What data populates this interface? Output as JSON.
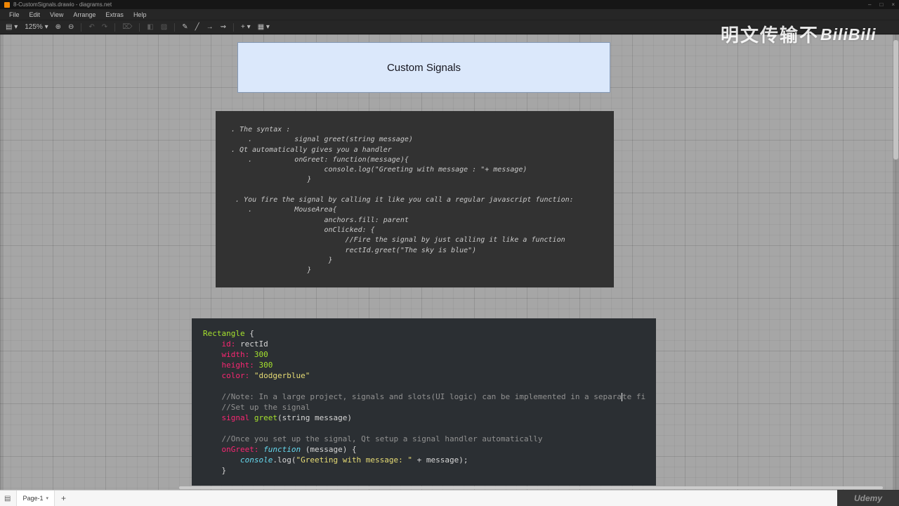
{
  "window": {
    "title": "8-CustomSignals.drawio - diagrams.net",
    "controls": {
      "minimize": "–",
      "maximize": "□",
      "close": "×"
    }
  },
  "menubar": [
    "File",
    "Edit",
    "View",
    "Arrange",
    "Extras",
    "Help"
  ],
  "toolbar": {
    "zoom_value": "125%",
    "buttons": [
      {
        "name": "diagram-menu",
        "glyph": "▤ ▾",
        "enabled": true
      },
      {
        "name": "zoom-dropdown",
        "glyph": "125% ▾",
        "enabled": true
      },
      {
        "name": "zoom-in",
        "glyph": "⊕",
        "enabled": true
      },
      {
        "name": "zoom-out",
        "glyph": "⊖",
        "enabled": true
      },
      {
        "name": "separator",
        "glyph": "",
        "sep": true
      },
      {
        "name": "undo",
        "glyph": "↶",
        "enabled": false
      },
      {
        "name": "redo",
        "glyph": "↷",
        "enabled": false
      },
      {
        "name": "separator",
        "glyph": "",
        "sep": true
      },
      {
        "name": "delete",
        "glyph": "⌦",
        "enabled": false
      },
      {
        "name": "separator",
        "glyph": "",
        "sep": true
      },
      {
        "name": "fill-color",
        "glyph": "◧",
        "enabled": false
      },
      {
        "name": "shadow",
        "glyph": "▨",
        "enabled": false
      },
      {
        "name": "separator",
        "glyph": "",
        "sep": true
      },
      {
        "name": "pencil",
        "glyph": "✎",
        "enabled": true
      },
      {
        "name": "line-style",
        "glyph": "╱",
        "enabled": true
      },
      {
        "name": "connection-arrow",
        "glyph": "→",
        "enabled": true
      },
      {
        "name": "waypoint-style",
        "glyph": "⇝",
        "enabled": true
      },
      {
        "name": "separator",
        "glyph": "",
        "sep": true
      },
      {
        "name": "insert",
        "glyph": "+ ▾",
        "enabled": true
      },
      {
        "name": "table",
        "glyph": "▦ ▾",
        "enabled": true
      }
    ]
  },
  "canvas": {
    "title_box": {
      "text": "Custom Signals",
      "fill": "#dbe8fb",
      "border": "#8499b7"
    },
    "notes_box": {
      "fill": "#323232",
      "lines": [
        ". The syntax :",
        "    .          signal greet(string message)",
        ". Qt automatically gives you a handler",
        "    .          onGreet: function(message){",
        "                      console.log(\"Greeting with message : \"+ message)",
        "                  }",
        "",
        " . You fire the signal by calling it like you call a regular javascript function:",
        "    .          MouseArea{",
        "                      anchors.fill: parent",
        "                      onClicked: {",
        "                           //Fire the signal by just calling it like a function",
        "                           rectId.greet(\"The sky is blue\")",
        "                       }",
        "                  }"
      ]
    },
    "code_box": {
      "fill": "#2b2f33",
      "palette": {
        "keyword": "#f92672",
        "type": "#a6e22e",
        "number": "#a6e22e",
        "string": "#e6db74",
        "builtin": "#66d9ef",
        "comment": "#919191",
        "plain": "#d6d6d6"
      },
      "lines": [
        [
          {
            "t": "Rectangle",
            "c": "g"
          },
          {
            "t": " {",
            "c": "p"
          }
        ],
        [
          {
            "t": "    ",
            "c": "p"
          },
          {
            "t": "id:",
            "c": "k"
          },
          {
            "t": " rectId",
            "c": "p"
          }
        ],
        [
          {
            "t": "    ",
            "c": "p"
          },
          {
            "t": "width:",
            "c": "k"
          },
          {
            "t": " ",
            "c": "p"
          },
          {
            "t": "300",
            "c": "n"
          }
        ],
        [
          {
            "t": "    ",
            "c": "p"
          },
          {
            "t": "height:",
            "c": "k"
          },
          {
            "t": " ",
            "c": "p"
          },
          {
            "t": "300",
            "c": "n"
          }
        ],
        [
          {
            "t": "    ",
            "c": "p"
          },
          {
            "t": "color:",
            "c": "k"
          },
          {
            "t": " ",
            "c": "p"
          },
          {
            "t": "\"dodgerblue\"",
            "c": "s"
          }
        ],
        [],
        [
          {
            "t": "    ",
            "c": "p"
          },
          {
            "t": "//Note: In a large project, signals and slots(UI logic) can be implemented in a separa",
            "c": "c"
          },
          {
            "t": "",
            "c": "caret"
          },
          {
            "t": "te fi",
            "c": "c"
          }
        ],
        [
          {
            "t": "    ",
            "c": "p"
          },
          {
            "t": "//Set up the signal",
            "c": "c"
          }
        ],
        [
          {
            "t": "    ",
            "c": "p"
          },
          {
            "t": "signal",
            "c": "k"
          },
          {
            "t": " ",
            "c": "p"
          },
          {
            "t": "greet",
            "c": "g"
          },
          {
            "t": "(string message)",
            "c": "p"
          }
        ],
        [],
        [
          {
            "t": "    ",
            "c": "p"
          },
          {
            "t": "//Once you set up the signal, Qt setup a signal handler automatically",
            "c": "c"
          }
        ],
        [
          {
            "t": "    ",
            "c": "p"
          },
          {
            "t": "onGreet:",
            "c": "k"
          },
          {
            "t": " ",
            "c": "p"
          },
          {
            "t": "function",
            "c": "b"
          },
          {
            "t": " (message) {",
            "c": "p"
          }
        ],
        [
          {
            "t": "        ",
            "c": "p"
          },
          {
            "t": "console",
            "c": "b"
          },
          {
            "t": ".log(",
            "c": "p"
          },
          {
            "t": "\"Greeting with message: \"",
            "c": "s"
          },
          {
            "t": " + message);",
            "c": "p"
          }
        ],
        [
          {
            "t": "    ",
            "c": "p"
          },
          {
            "t": "}",
            "c": "p"
          }
        ]
      ]
    }
  },
  "statusbar": {
    "page_tab": "Page-1",
    "tab_caret": "▾",
    "add_label": "+",
    "pages_icon": "▤"
  },
  "watermarks": {
    "top_text": "明文传输不",
    "logo_text": "BiliBili",
    "bottom_text": "Udemy"
  }
}
